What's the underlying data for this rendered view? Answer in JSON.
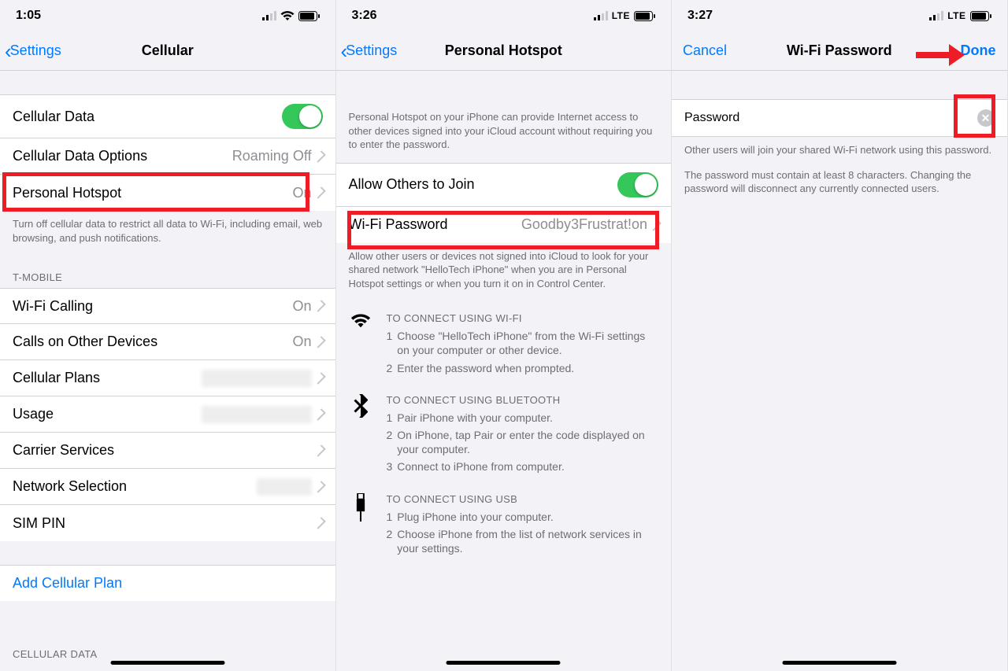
{
  "screen1": {
    "time": "1:05",
    "signal_type": "wifi",
    "back_label": "Settings",
    "title": "Cellular",
    "rows": {
      "cellular_data": "Cellular Data",
      "cellular_data_options": "Cellular Data Options",
      "cellular_data_options_val": "Roaming Off",
      "personal_hotspot": "Personal Hotspot",
      "personal_hotspot_val": "On",
      "wifi_calling": "Wi-Fi Calling",
      "wifi_calling_val": "On",
      "calls_other": "Calls on Other Devices",
      "calls_other_val": "On",
      "cellular_plans": "Cellular Plans",
      "usage": "Usage",
      "carrier_services": "Carrier Services",
      "network_selection": "Network Selection",
      "sim_pin": "SIM PIN",
      "add_plan": "Add Cellular Plan"
    },
    "carrier_header": "T-MOBILE",
    "bottom_header": "CELLULAR DATA",
    "footer1": "Turn off cellular data to restrict all data to Wi-Fi, including email, web browsing, and push notifications."
  },
  "screen2": {
    "time": "3:26",
    "signal_type": "lte",
    "back_label": "Settings",
    "title": "Personal Hotspot",
    "intro": "Personal Hotspot on your iPhone can provide Internet access to other devices signed into your iCloud account without requiring you to enter the password.",
    "rows": {
      "allow_others": "Allow Others to Join",
      "wifi_password": "Wi-Fi Password",
      "wifi_password_val": "Goodby3Frustrat!on"
    },
    "footer2": "Allow other users or devices not signed into iCloud to look for your shared network \"HelloTech iPhone\" when you are in Personal Hotspot settings or when you turn it on in Control Center.",
    "instr": {
      "wifi_title": "TO CONNECT USING WI-FI",
      "wifi_s1": "Choose \"HelloTech iPhone\" from the Wi-Fi settings on your computer or other device.",
      "wifi_s2": "Enter the password when prompted.",
      "bt_title": "TO CONNECT USING BLUETOOTH",
      "bt_s1": "Pair iPhone with your computer.",
      "bt_s2": "On iPhone, tap Pair or enter the code displayed on your computer.",
      "bt_s3": "Connect to iPhone from computer.",
      "usb_title": "TO CONNECT USING USB",
      "usb_s1": "Plug iPhone into your computer.",
      "usb_s2": "Choose iPhone from the list of network services in your settings."
    }
  },
  "screen3": {
    "time": "3:27",
    "signal_type": "lte",
    "cancel": "Cancel",
    "title": "Wi-Fi Password",
    "done": "Done",
    "input_label": "Password",
    "input_value": "",
    "footer_a": "Other users will join your shared Wi-Fi network using this password.",
    "footer_b": "The password must contain at least 8 characters. Changing the password will disconnect any currently connected users."
  }
}
